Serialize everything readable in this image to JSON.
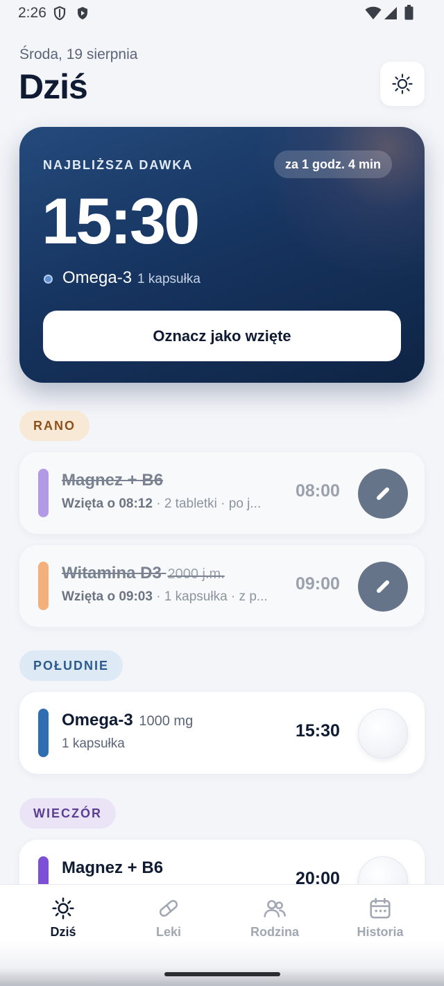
{
  "status_bar": {
    "time": "2:26"
  },
  "header": {
    "date": "Środa, 19 sierpnia",
    "title": "Dziś"
  },
  "next_dose": {
    "label": "NAJBLIŻSZA DAWKA",
    "countdown": "za 1 godz. 4 min",
    "time": "15:30",
    "medication": "Omega-3",
    "dose": "1 kapsułka",
    "action_label": "Oznacz jako wzięte"
  },
  "sections": {
    "morning": {
      "label": "RANO",
      "items": [
        {
          "name": "Magnez + B6",
          "strength": "",
          "taken_at": "Wzięta o 08:12",
          "details": " · 2 tabletki · po j...",
          "time": "08:00",
          "color": "#b39ae6"
        },
        {
          "name": "Witamina D3",
          "strength": "2000 j.m.",
          "taken_at": "Wzięta o 09:03",
          "details": " · 1 kapsułka · z p...",
          "time": "09:00",
          "color": "#f4b07a"
        }
      ]
    },
    "noon": {
      "label": "POŁUDNIE",
      "items": [
        {
          "name": "Omega-3",
          "strength": "1000 mg",
          "details": "1 kapsułka",
          "time": "15:30",
          "color": "#2f6db3"
        }
      ]
    },
    "evening": {
      "label": "WIECZÓR",
      "items": [
        {
          "name": "Magnez + B6",
          "time": "20:00",
          "color": "#7b4fd6"
        }
      ]
    }
  },
  "nav": {
    "today": "Dziś",
    "meds": "Leki",
    "family": "Rodzina",
    "history": "Historia"
  },
  "colors": {
    "accent": "#173561",
    "background": "#f3f5f9",
    "text": "#0f1b33"
  }
}
